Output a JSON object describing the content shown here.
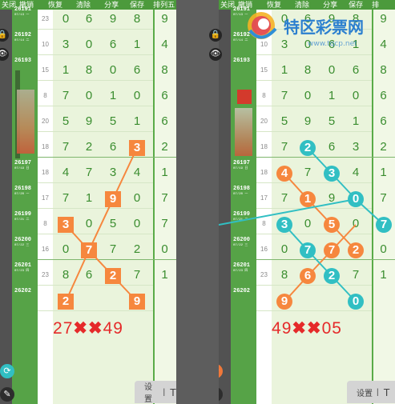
{
  "toolbar": {
    "items": [
      "撤销",
      "恢复",
      "清除",
      "分享",
      "保存",
      "排列五",
      "关闭"
    ]
  },
  "left_toolbar": [
    "撤销",
    "恢复",
    "清除",
    "分享",
    "保存",
    "排列五",
    "关闭"
  ],
  "right_toolbar": [
    "关闭",
    "撤销",
    "恢复",
    "清除",
    "分享",
    "保存",
    "排"
  ],
  "issues": [
    {
      "no": "26191",
      "date": "07/13 一"
    },
    {
      "no": "26192",
      "date": "07/14 二"
    },
    {
      "no": "26193",
      "date": ""
    },
    {
      "no": "",
      "date": ""
    },
    {
      "no": "",
      "date": ""
    },
    {
      "no": "",
      "date": ""
    },
    {
      "no": "26197",
      "date": "07/19 日"
    },
    {
      "no": "26198",
      "date": "07/20 一"
    },
    {
      "no": "26199",
      "date": "07/21 二"
    },
    {
      "no": "26200",
      "date": "07/22 三"
    },
    {
      "no": "26201",
      "date": "07/23 四"
    },
    {
      "no": "26202",
      "date": ""
    }
  ],
  "sums": [
    "23",
    "10",
    "15",
    "8",
    "20",
    "18",
    "18",
    "17",
    "8",
    "16",
    "23",
    ""
  ],
  "rows": [
    [
      "0",
      "6",
      "9",
      "8"
    ],
    [
      "3",
      "0",
      "6",
      "1"
    ],
    [
      "1",
      "8",
      "0",
      "6"
    ],
    [
      "7",
      "0",
      "1",
      "0"
    ],
    [
      "5",
      "9",
      "5",
      "1"
    ],
    [
      "7",
      "2",
      "6",
      "3"
    ],
    [
      "4",
      "7",
      "3",
      "4"
    ],
    [
      "7",
      "1",
      "9",
      "0"
    ],
    [
      "3",
      "0",
      "5",
      "0"
    ],
    [
      "0",
      "7",
      "7",
      "2"
    ],
    [
      "8",
      "6",
      "2",
      "7"
    ],
    [
      "",
      "",
      "",
      ""
    ]
  ],
  "side": [
    "9",
    "4",
    "8",
    "6",
    "6",
    "2",
    "1",
    "7",
    "7",
    "0",
    "1",
    ""
  ],
  "left_result": {
    "a": "27",
    "x": "✖✖",
    "b": "49"
  },
  "right_result": {
    "a": "49",
    "x": "✖✖",
    "b": "05"
  },
  "left_next": [
    "2",
    "9"
  ],
  "right_next": [
    "9",
    "0"
  ],
  "settings_label": "设置",
  "settings_sep": "|",
  "settings_icon": "T",
  "logo": {
    "title": "特区彩票网",
    "url": "www.tqcp.net"
  },
  "colors": {
    "orange": "#f6873e",
    "teal": "#31bfc3",
    "green": "#3a8d2f",
    "red": "#e52a2a"
  }
}
